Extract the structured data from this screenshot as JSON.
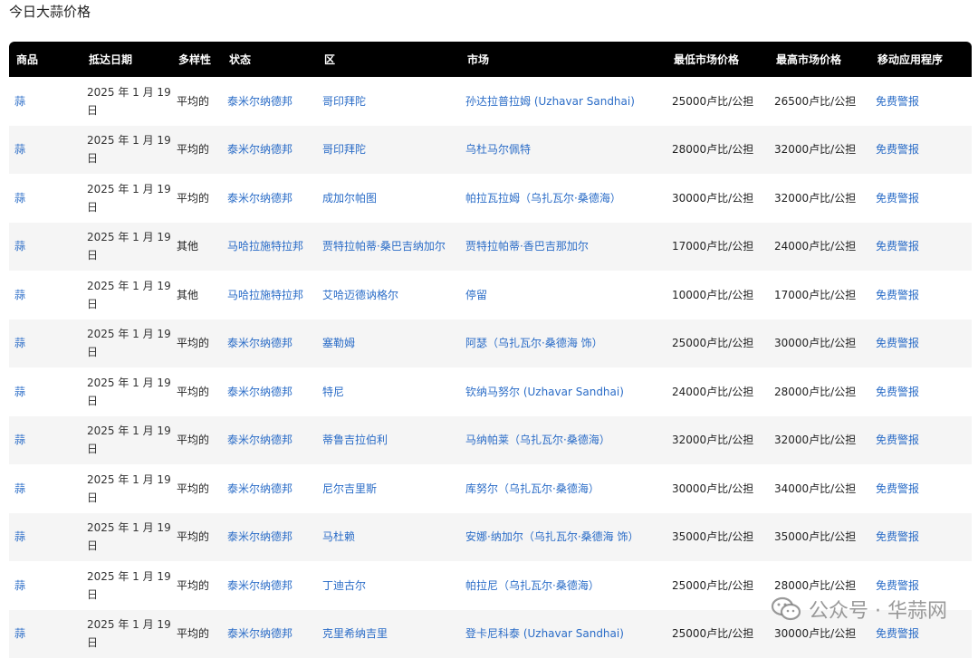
{
  "page": {
    "title": "今日大蒜价格"
  },
  "table": {
    "headers": [
      "商品",
      "抵达日期",
      "多样性",
      "状态",
      "区",
      "市场",
      "最低市场价格",
      "最高市场价格",
      "移动应用程序"
    ],
    "rows": [
      {
        "commodity": "蒜",
        "date": "2025 年 1 月 19 日",
        "variety": "平均的",
        "state": "泰米尔纳德邦",
        "district": "哥印拜陀",
        "market": "孙达拉普拉姆 (Uzhavar Sandhai)",
        "min": "25000卢比/公担",
        "max": "26500卢比/公担",
        "app": "免费警报"
      },
      {
        "commodity": "蒜",
        "date": "2025 年 1 月 19 日",
        "variety": "平均的",
        "state": "泰米尔纳德邦",
        "district": "哥印拜陀",
        "market": "乌杜马尔佩特",
        "min": "28000卢比/公担",
        "max": "32000卢比/公担",
        "app": "免费警报"
      },
      {
        "commodity": "蒜",
        "date": "2025 年 1 月 19 日",
        "variety": "平均的",
        "state": "泰米尔纳德邦",
        "district": "成加尔帕图",
        "market": "帕拉瓦拉姆（乌扎瓦尔·桑德海）",
        "min": "30000卢比/公担",
        "max": "32000卢比/公担",
        "app": "免费警报"
      },
      {
        "commodity": "蒜",
        "date": "2025 年 1 月 19 日",
        "variety": "其他",
        "state": "马哈拉施特拉邦",
        "district": "贾特拉帕蒂·桑巴吉纳加尔",
        "market": "贾特拉帕蒂·香巴吉那加尔",
        "min": "17000卢比/公担",
        "max": "24000卢比/公担",
        "app": "免费警报"
      },
      {
        "commodity": "蒜",
        "date": "2025 年 1 月 19 日",
        "variety": "其他",
        "state": "马哈拉施特拉邦",
        "district": "艾哈迈德讷格尔",
        "market": "停留",
        "min": "10000卢比/公担",
        "max": "17000卢比/公担",
        "app": "免费警报"
      },
      {
        "commodity": "蒜",
        "date": "2025 年 1 月 19 日",
        "variety": "平均的",
        "state": "泰米尔纳德邦",
        "district": "塞勒姆",
        "market": "阿瑟（乌扎瓦尔·桑德海 饰）",
        "min": "25000卢比/公担",
        "max": "30000卢比/公担",
        "app": "免费警报"
      },
      {
        "commodity": "蒜",
        "date": "2025 年 1 月 19 日",
        "variety": "平均的",
        "state": "泰米尔纳德邦",
        "district": "特尼",
        "market": "钦纳马努尔 (Uzhavar Sandhai)",
        "min": "24000卢比/公担",
        "max": "28000卢比/公担",
        "app": "免费警报"
      },
      {
        "commodity": "蒜",
        "date": "2025 年 1 月 19 日",
        "variety": "平均的",
        "state": "泰米尔纳德邦",
        "district": "蒂鲁吉拉伯利",
        "market": "马纳帕莱（乌扎瓦尔·桑德海）",
        "min": "32000卢比/公担",
        "max": "32000卢比/公担",
        "app": "免费警报"
      },
      {
        "commodity": "蒜",
        "date": "2025 年 1 月 19 日",
        "variety": "平均的",
        "state": "泰米尔纳德邦",
        "district": "尼尔吉里斯",
        "market": "库努尔（乌扎瓦尔·桑德海）",
        "min": "30000卢比/公担",
        "max": "34000卢比/公担",
        "app": "免费警报"
      },
      {
        "commodity": "蒜",
        "date": "2025 年 1 月 19 日",
        "variety": "平均的",
        "state": "泰米尔纳德邦",
        "district": "马杜赖",
        "market": "安娜·纳加尔（乌扎瓦尔·桑德海 饰）",
        "min": "35000卢比/公担",
        "max": "35000卢比/公担",
        "app": "免费警报"
      },
      {
        "commodity": "蒜",
        "date": "2025 年 1 月 19 日",
        "variety": "平均的",
        "state": "泰米尔纳德邦",
        "district": "丁迪古尔",
        "market": "帕拉尼（乌扎瓦尔·桑德海）",
        "min": "25000卢比/公担",
        "max": "28000卢比/公担",
        "app": "免费警报"
      },
      {
        "commodity": "蒜",
        "date": "2025 年 1 月 19 日",
        "variety": "平均的",
        "state": "泰米尔纳德邦",
        "district": "克里希纳吉里",
        "market": "登卡尼科泰 (Uzhavar Sandhai)",
        "min": "25000卢比/公担",
        "max": "30000卢比/公担",
        "app": "免费警报"
      }
    ]
  },
  "watermark": {
    "text": "公众号 · 华蒜网",
    "icon": "wechat-icon"
  },
  "colors": {
    "header_bg": "#000000",
    "link": "#2a6cc7",
    "stripe": "#f5f5f5"
  }
}
